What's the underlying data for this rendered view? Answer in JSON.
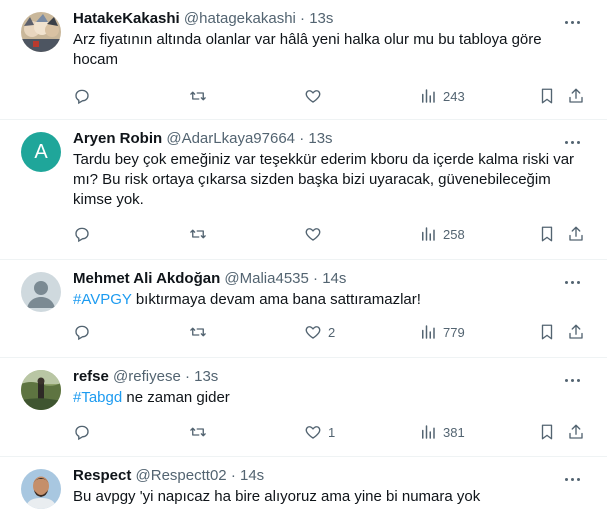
{
  "tweets": [
    {
      "name": "HatakeKakashi",
      "handle": "@hatagekakashi",
      "time": "13s",
      "text": "Arz fiyatının altında olanlar var hâlâ yeni halka olur mu bu tabloya göre hocam",
      "hashtag": "",
      "replies": "",
      "retweets": "",
      "likes": "",
      "views": "243",
      "avatar_letter": ""
    },
    {
      "name": "Aryen Robin",
      "handle": "@AdarLkaya97664",
      "time": "13s",
      "text": "Tardu bey çok emeğiniz var teşekkür ederim kboru da içerde kalma riski var mı? Bu risk ortaya çıkarsa sizden başka bizi uyaracak, güvenebileceğim kimse yok.",
      "hashtag": "",
      "replies": "",
      "retweets": "",
      "likes": "",
      "views": "258",
      "avatar_letter": "A"
    },
    {
      "name": "Mehmet Ali Akdoğan",
      "handle": "@Malia4535",
      "time": "14s",
      "text": " bıktırmaya devam ama bana sattıramazlar!",
      "hashtag": "#AVPGY",
      "replies": "",
      "retweets": "",
      "likes": "2",
      "views": "779",
      "avatar_letter": ""
    },
    {
      "name": "refse",
      "handle": "@refiyese",
      "time": "13s",
      "text": " ne zaman gider",
      "hashtag": "#Tabgd",
      "replies": "",
      "retweets": "",
      "likes": "1",
      "views": "381",
      "avatar_letter": ""
    },
    {
      "name": "Respect",
      "handle": "@Respectt02",
      "time": "14s",
      "text": "Bu avpgy 'yi napıcaz ha bire alıyoruz ama yine bi numara yok",
      "hashtag": "",
      "avatar_letter": ""
    }
  ],
  "separator": "·",
  "colors": {
    "accent": "#1d9bf0",
    "muted": "#536471",
    "text": "#0f1419",
    "avatar_a": "#1fa69a"
  },
  "icons": [
    "reply-icon",
    "retweet-icon",
    "like-icon",
    "views-icon",
    "bookmark-icon",
    "share-icon",
    "more-icon"
  ]
}
